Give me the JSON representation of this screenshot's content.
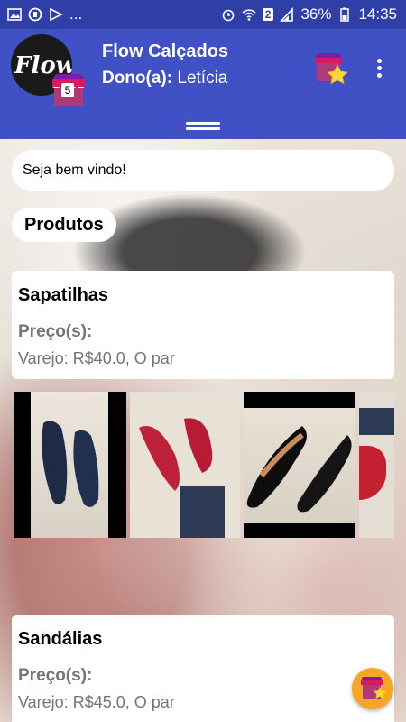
{
  "status_bar": {
    "time": "14:35",
    "battery": "36%",
    "sim": "2",
    "more": "..."
  },
  "header": {
    "store_name": "Flow Calçados",
    "owner_label": "Dono(a):",
    "owner_name": "Letícia",
    "logo_text": "Flow",
    "badge_count": "5"
  },
  "welcome": "Seja bem vindo!",
  "section_title": "Produtos",
  "products": [
    {
      "name": "Sapatilhas",
      "price_label": "Preço(s):",
      "price": "Varejo: R$40.0, O par"
    },
    {
      "name": "Sandálias",
      "price_label": "Preço(s):",
      "price": "Varejo: R$45.0, O par"
    }
  ],
  "colors": {
    "status_bar": "#2f3fa8",
    "app_bar": "#3f51c4",
    "fab": "#f5a623"
  }
}
